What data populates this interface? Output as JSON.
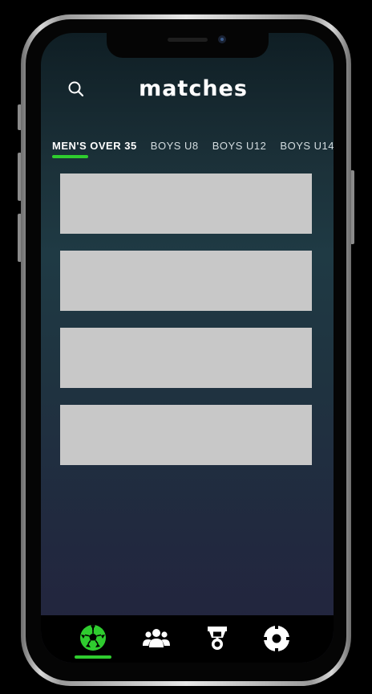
{
  "header": {
    "title": "matches",
    "search_icon": "search-icon"
  },
  "tabs": [
    {
      "label": "MEN'S OVER 35",
      "active": true
    },
    {
      "label": "BOYS U8",
      "active": false
    },
    {
      "label": "BOYS U12",
      "active": false
    },
    {
      "label": "BOYS U14",
      "active": false
    }
  ],
  "match_cards": [
    {
      "placeholder": true
    },
    {
      "placeholder": true
    },
    {
      "placeholder": true
    },
    {
      "placeholder": true
    }
  ],
  "bottom_nav": [
    {
      "icon": "soccer-ball-icon",
      "active": true
    },
    {
      "icon": "team-icon",
      "active": false
    },
    {
      "icon": "medal-icon",
      "active": false
    },
    {
      "icon": "settings-icon",
      "active": false
    }
  ],
  "colors": {
    "accent": "#2fcc2f",
    "card": "#c8c8c8",
    "nav_background": "#000000",
    "text": "#ffffff"
  }
}
